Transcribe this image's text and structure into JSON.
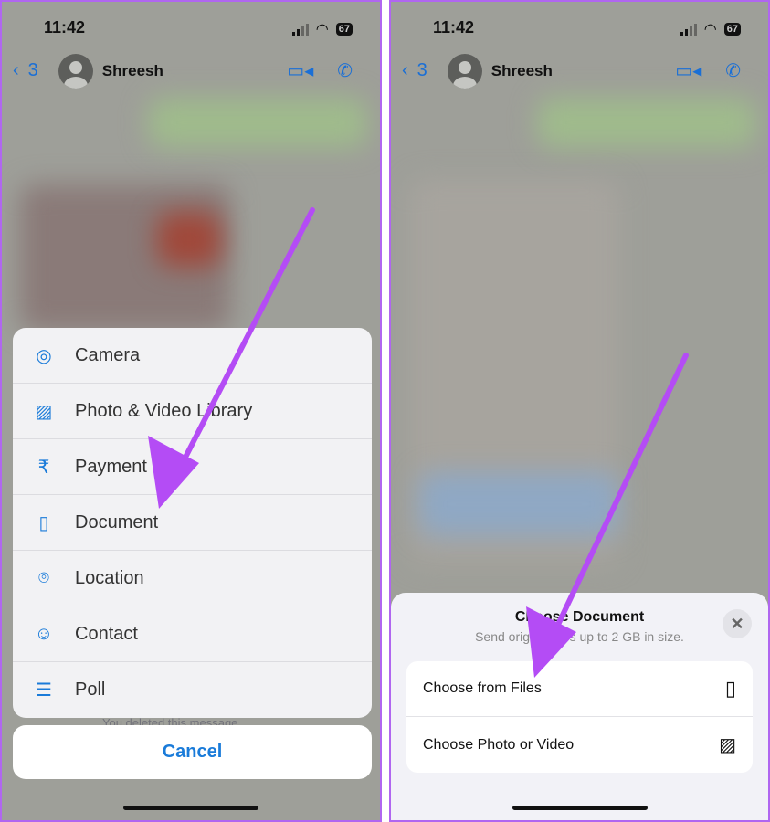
{
  "status": {
    "time": "11:42",
    "battery": "67"
  },
  "header": {
    "back_count": "3",
    "contact_name": "Shreesh",
    "icons": [
      "chevron-left-icon",
      "avatar",
      "video-icon",
      "phone-icon"
    ]
  },
  "left": {
    "menu": [
      {
        "label": "Camera",
        "icon": "camera-icon"
      },
      {
        "label": "Photo & Video Library",
        "icon": "photo-icon"
      },
      {
        "label": "Payment",
        "icon": "rupee-icon"
      },
      {
        "label": "Document",
        "icon": "document-icon"
      },
      {
        "label": "Location",
        "icon": "location-icon"
      },
      {
        "label": "Contact",
        "icon": "contact-icon"
      },
      {
        "label": "Poll",
        "icon": "poll-icon"
      }
    ],
    "cancel": "Cancel",
    "background_message": "You deleted this message"
  },
  "right": {
    "sheet_title": "Choose Document",
    "sheet_subtitle": "Send original files up to 2 GB in size.",
    "options": [
      {
        "label": "Choose from Files",
        "icon": "file-icon"
      },
      {
        "label": "Choose Photo or Video",
        "icon": "photos-icon"
      }
    ]
  },
  "colors": {
    "accent": "#1a7bd9",
    "annotation_arrow": "#b44cf5"
  }
}
